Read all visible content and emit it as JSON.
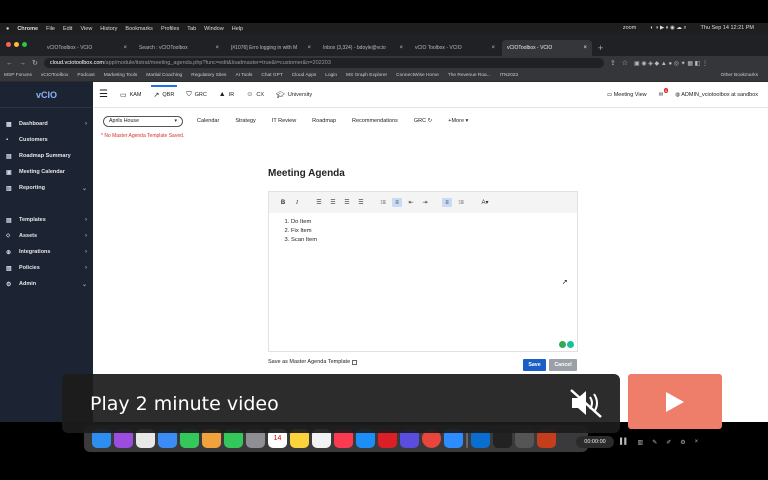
{
  "mac_menu": {
    "apple": "",
    "app": "Chrome",
    "items": [
      "File",
      "Edit",
      "View",
      "History",
      "Bookmarks",
      "Profiles",
      "Tab",
      "Window",
      "Help"
    ],
    "zoom_label": "zoom",
    "clock": "Thu Sep 14  12:21 PM"
  },
  "browser": {
    "tabs": [
      {
        "label": "vCIOToolbox - VCIO",
        "active": false
      },
      {
        "label": "Search : vCIOToolbox",
        "active": false
      },
      {
        "label": "[#1076] Erro logging in with M",
        "active": false
      },
      {
        "label": "Inbox (3,324) - bdoyle@vcio",
        "active": false
      },
      {
        "label": "vCIO Toolbox - VCIO",
        "active": false
      },
      {
        "label": "vCIOToolbox - VCIO",
        "active": true
      }
    ],
    "new_tab": "+",
    "url_host": "cloud.vciotoolbox.com",
    "url_path": "/app/module/itstrat/meeting_agenda.php?func=edit&loadmaster=true&t=customer&n=202203",
    "bookmarks": [
      "MSP Forums",
      "vCIOToolbox",
      "Podcast",
      "Marketing Tools",
      "Martial Coaching",
      "Regulatory Sites",
      "AI Tools",
      "Chat GPT",
      "Cloud Apps",
      "Login",
      "MS Graph Explorer",
      "ConnectWise Home",
      "The Revenue Roa...",
      "ITN2023",
      "Other Bookmarks"
    ]
  },
  "sidebar": {
    "logo": "vCIO",
    "items": [
      {
        "label": "Dashboard",
        "icon": "dashboard-icon"
      },
      {
        "label": "Customers",
        "icon": "customers-icon"
      },
      {
        "label": "Roadmap Summary",
        "icon": "roadmap-icon"
      },
      {
        "label": "Meeting Calendar",
        "icon": "calendar-icon"
      },
      {
        "label": "Reporting",
        "icon": "reporting-icon"
      },
      {
        "label": "Templates",
        "icon": "templates-icon"
      },
      {
        "label": "Assets",
        "icon": "assets-icon"
      },
      {
        "label": "Integrations",
        "icon": "integrations-icon"
      },
      {
        "label": "Policies",
        "icon": "policies-icon"
      },
      {
        "label": "Admin",
        "icon": "admin-icon"
      }
    ]
  },
  "topnav": {
    "items": [
      "KAM",
      "QBR",
      "GRC",
      "IR",
      "CX",
      "University"
    ],
    "active": "QBR",
    "meeting_view": "Meeting View",
    "notif_count": "4",
    "user": "ADMIN_vciotoolbox at sandbox"
  },
  "subnav": {
    "client": "Aprils House",
    "items": [
      "Calendar",
      "Strategy",
      "IT Review",
      "Roadmap",
      "Recommendations",
      "GRC",
      "+More"
    ]
  },
  "warning": "* No Master Agenda Template Saved.",
  "page": {
    "title": "Meeting Agenda"
  },
  "editor": {
    "toolbar": [
      "B",
      "I",
      "align-left",
      "align-center",
      "align-right",
      "justify",
      "bulleted-list",
      "numbered-list",
      "outdent",
      "indent",
      "numbered-list-alt",
      "bulleted-list-alt",
      "text-color"
    ],
    "list_items": [
      "Do Item",
      "Fix Item",
      "Scan Item"
    ]
  },
  "save_template_label": "Save as Master Agenda Template",
  "save_label": "Save",
  "cancel_label": "Cancel",
  "dock": {
    "timer": "00:00:00",
    "calendar_day": "14"
  },
  "video": {
    "play_label": "Play 2 minute video"
  },
  "colors": {
    "sidebar": "#1c2333",
    "accent": "#1a73e8",
    "save": "#1a5fc5",
    "cancel": "#9aa0a6",
    "play_button": "#ee7d69",
    "warning": "#d93025"
  }
}
